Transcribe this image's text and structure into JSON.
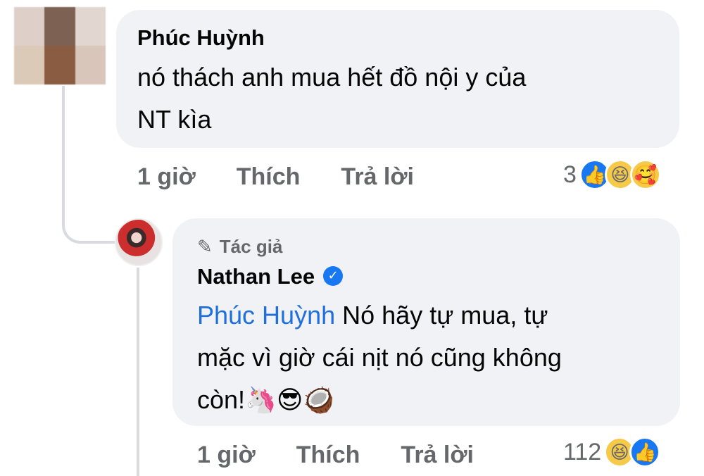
{
  "comment": {
    "author": "Phúc Huỳnh",
    "text_line1": "nó thách anh mua hết đồ nội y của",
    "text_line2": "NT kìa",
    "time": "1 giờ",
    "like_label": "Thích",
    "reply_label": "Trả lời",
    "reaction_count": "3",
    "reactions": [
      "like-icon",
      "haha-icon",
      "care-icon"
    ]
  },
  "reply": {
    "badge_label": "Tác giả",
    "author": "Nathan Lee",
    "mention": "Phúc Huỳnh",
    "text_line1": " Nó hãy tự mua, tự",
    "text_line2": "mặc vì giờ cái nịt nó cũng không",
    "text_line3": "còn!",
    "emojis": [
      "🦄",
      "😎",
      "🥥"
    ],
    "time": "1 giờ",
    "like_label": "Thích",
    "reply_label": "Trả lời",
    "reaction_count": "112",
    "reactions": [
      "haha-icon",
      "like-icon"
    ]
  },
  "colors": {
    "bubble": "#f0f2f5",
    "mention": "#216fdb",
    "secondary_text": "#65676b",
    "facebook_blue": "#1877f2"
  }
}
